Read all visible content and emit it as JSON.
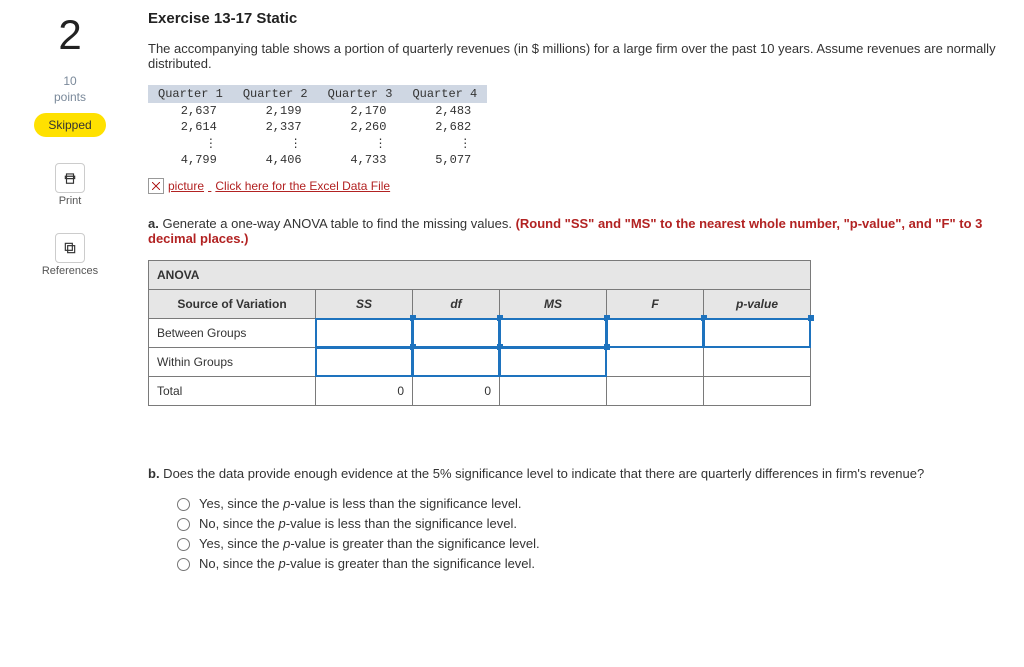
{
  "side": {
    "number": "2",
    "points_value": "10",
    "points_label": "points",
    "skipped": "Skipped",
    "print": "Print",
    "references": "References"
  },
  "title": "Exercise 13-17 Static",
  "intro": "The accompanying table shows a portion of quarterly revenues (in $ millions) for a large firm over the past 10 years. Assume revenues are normally distributed.",
  "data_headers": [
    "Quarter 1",
    "Quarter 2",
    "Quarter 3",
    "Quarter 4"
  ],
  "data_rows": [
    [
      "2,637",
      "2,199",
      "2,170",
      "2,483"
    ],
    [
      "2,614",
      "2,337",
      "2,260",
      "2,682"
    ],
    [
      "⋮",
      "⋮",
      "⋮",
      "⋮"
    ],
    [
      "4,799",
      "4,406",
      "4,733",
      "5,077"
    ]
  ],
  "excel_alt": "picture",
  "excel_link": "Click here for the Excel Data File",
  "part_a": {
    "label": "a.",
    "text": " Generate a one-way ANOVA table to find the missing values. ",
    "round": "(Round \"SS\" and \"MS\" to the nearest whole number, \"p-value\", and \"F\" to 3 decimal places.)"
  },
  "anova": {
    "title": "ANOVA",
    "cols": [
      "Source of Variation",
      "SS",
      "df",
      "MS",
      "F",
      "p-value"
    ],
    "rows": [
      "Between Groups",
      "Within Groups",
      "Total"
    ],
    "total_ss": "0",
    "total_df": "0"
  },
  "part_b": {
    "label": "b.",
    "text": " Does the data provide enough evidence at the 5% significance level to indicate that there are quarterly differences in firm's revenue?"
  },
  "options": [
    {
      "pre": "Yes, since the ",
      "mid": "p",
      "post": "-value is less than the significance level."
    },
    {
      "pre": "No, since the ",
      "mid": "p",
      "post": "-value is less than the significance level."
    },
    {
      "pre": "Yes, since the ",
      "mid": "p",
      "post": "-value is greater than the significance level."
    },
    {
      "pre": "No, since the ",
      "mid": "p",
      "post": "-value is greater than the significance level."
    }
  ]
}
